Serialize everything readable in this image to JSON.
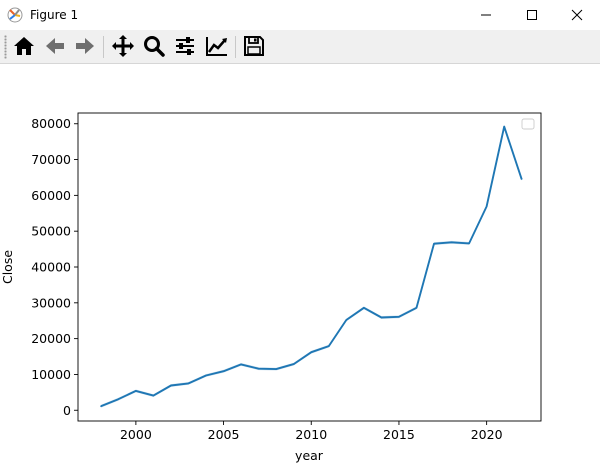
{
  "window": {
    "title": "Figure 1"
  },
  "toolbar": {
    "buttons": [
      {
        "name": "home-icon"
      },
      {
        "name": "back-arrow-icon"
      },
      {
        "name": "forward-arrow-icon"
      },
      {
        "name": "pan-icon"
      },
      {
        "name": "zoom-icon"
      },
      {
        "name": "configure-subplots-icon"
      },
      {
        "name": "edit-axis-icon"
      },
      {
        "name": "save-icon"
      }
    ]
  },
  "chart_data": {
    "type": "line",
    "xlabel": "year",
    "ylabel": "Close",
    "xlim": [
      1996.7,
      2023.1
    ],
    "ylim": [
      -3000,
      83000
    ],
    "xticks": [
      2000,
      2005,
      2010,
      2015,
      2020
    ],
    "yticks": [
      0,
      10000,
      20000,
      30000,
      40000,
      50000,
      60000,
      70000,
      80000
    ],
    "color": "#1f77b4",
    "legend": "upper right (empty)",
    "series": [
      {
        "x": [
          1998,
          1999,
          2000,
          2001,
          2002,
          2003,
          2004,
          2005,
          2006,
          2007,
          2008,
          2009,
          2010,
          2011,
          2012,
          2013,
          2014,
          2015,
          2016,
          2017,
          2018,
          2019,
          2020,
          2021,
          2022
        ],
        "values": [
          1100,
          3100,
          5400,
          4100,
          6900,
          7500,
          9700,
          10900,
          12800,
          11600,
          11500,
          12900,
          16200,
          17900,
          25200,
          28600,
          25900,
          26100,
          28600,
          46500,
          46900,
          46600,
          56900,
          79200,
          64500
        ]
      }
    ]
  }
}
